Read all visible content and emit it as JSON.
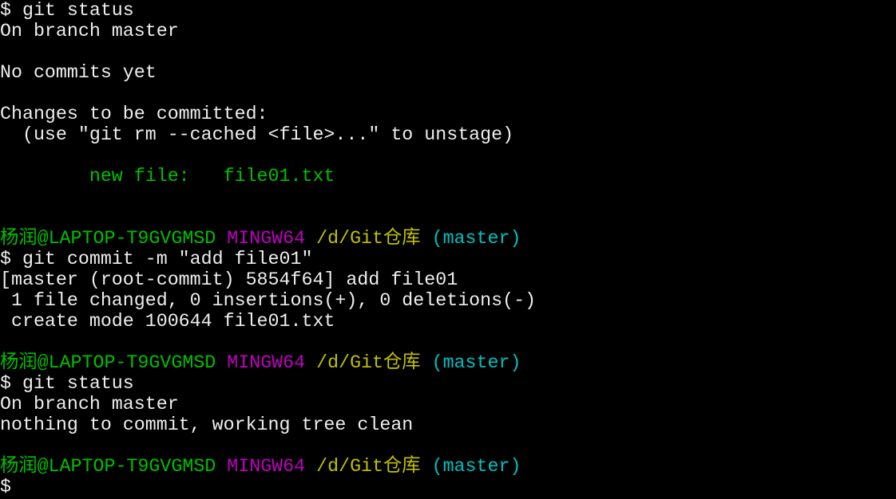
{
  "terminal": {
    "colors": {
      "white": "#eeeeee",
      "green": "#00c000",
      "magenta": "#c000c0",
      "yellow": "#c0c000",
      "cyan": "#00c0c0"
    },
    "lines": [
      [
        {
          "t": "$ git status",
          "c": "white"
        }
      ],
      [
        {
          "t": "On branch master",
          "c": "white"
        }
      ],
      [],
      [
        {
          "t": "No commits yet",
          "c": "white"
        }
      ],
      [],
      [
        {
          "t": "Changes to be committed:",
          "c": "white"
        }
      ],
      [
        {
          "t": "  (use \"git rm --cached <file>...\" to unstage)",
          "c": "white"
        }
      ],
      [],
      [
        {
          "t": "        new file:   file01.txt",
          "c": "green"
        }
      ],
      [],
      [],
      [
        {
          "t": "杨润@LAPTOP-T9GVGMSD",
          "c": "green"
        },
        {
          "t": " ",
          "c": "white"
        },
        {
          "t": "MINGW64",
          "c": "magenta"
        },
        {
          "t": " ",
          "c": "white"
        },
        {
          "t": "/d/Git仓库",
          "c": "yellow"
        },
        {
          "t": " ",
          "c": "white"
        },
        {
          "t": "(master)",
          "c": "cyan"
        }
      ],
      [
        {
          "t": "$ git commit -m \"add file01\"",
          "c": "white"
        }
      ],
      [
        {
          "t": "[master (root-commit) 5854f64] add file01",
          "c": "white"
        }
      ],
      [
        {
          "t": " 1 file changed, 0 insertions(+), 0 deletions(-)",
          "c": "white"
        }
      ],
      [
        {
          "t": " create mode 100644 file01.txt",
          "c": "white"
        }
      ],
      [],
      [
        {
          "t": "杨润@LAPTOP-T9GVGMSD",
          "c": "green"
        },
        {
          "t": " ",
          "c": "white"
        },
        {
          "t": "MINGW64",
          "c": "magenta"
        },
        {
          "t": " ",
          "c": "white"
        },
        {
          "t": "/d/Git仓库",
          "c": "yellow"
        },
        {
          "t": " ",
          "c": "white"
        },
        {
          "t": "(master)",
          "c": "cyan"
        }
      ],
      [
        {
          "t": "$ git status",
          "c": "white"
        }
      ],
      [
        {
          "t": "On branch master",
          "c": "white"
        }
      ],
      [
        {
          "t": "nothing to commit, working tree clean",
          "c": "white"
        }
      ],
      [],
      [
        {
          "t": "杨润@LAPTOP-T9GVGMSD",
          "c": "green"
        },
        {
          "t": " ",
          "c": "white"
        },
        {
          "t": "MINGW64",
          "c": "magenta"
        },
        {
          "t": " ",
          "c": "white"
        },
        {
          "t": "/d/Git仓库",
          "c": "yellow"
        },
        {
          "t": " ",
          "c": "white"
        },
        {
          "t": "(master)",
          "c": "cyan"
        }
      ],
      [
        {
          "t": "$",
          "c": "white"
        }
      ]
    ]
  }
}
